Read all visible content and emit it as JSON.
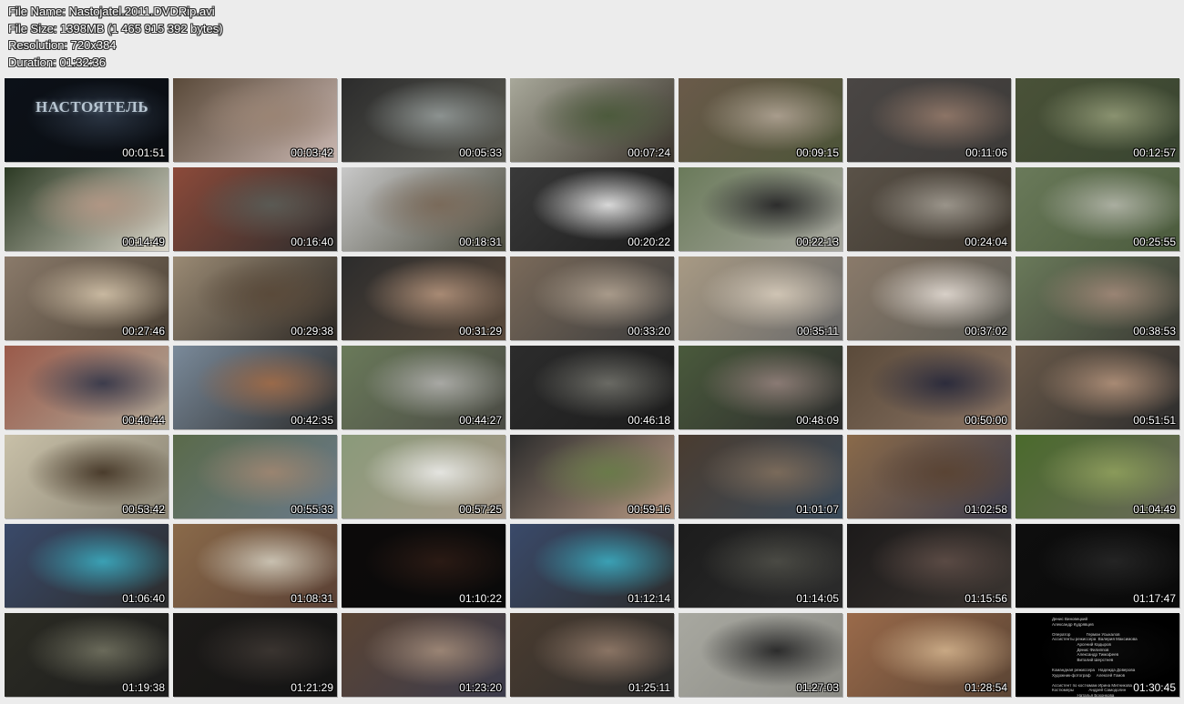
{
  "header": {
    "file_name": "File Name: Nastojatel.2011.DVDRip.avi",
    "file_size": "File Size: 1398MB (1 465 915 392 bytes)",
    "resolution": "Resolution: 720x384",
    "duration": "Duration: 01:32:36"
  },
  "first_frame_title": "НАСТОЯТЕЛЬ",
  "thumbnails": [
    {
      "time": "00:01:51",
      "colors": [
        "#0c1118",
        "#2a3442",
        "#0a0d12"
      ]
    },
    {
      "time": "00:03:42",
      "colors": [
        "#5a4a3a",
        "#9a8474",
        "#c9b6b0"
      ]
    },
    {
      "time": "00:05:33",
      "colors": [
        "#2c2c2c",
        "#8c9290",
        "#5a5a52"
      ]
    },
    {
      "time": "00:07:24",
      "colors": [
        "#a8a89a",
        "#4c5a3c",
        "#3a342c"
      ]
    },
    {
      "time": "00:09:15",
      "colors": [
        "#6a5a4a",
        "#a89c8c",
        "#4c5438"
      ]
    },
    {
      "time": "00:11:06",
      "colors": [
        "#4a4644",
        "#8c7466",
        "#3c3a38"
      ]
    },
    {
      "time": "00:12:57",
      "colors": [
        "#4a5238",
        "#8a9270",
        "#384430"
      ]
    },
    {
      "time": "00:14:49",
      "colors": [
        "#2c3a24",
        "#b09684",
        "#d8d4c8"
      ]
    },
    {
      "time": "00:16:40",
      "colors": [
        "#8c4a3a",
        "#5a5a54",
        "#2c2c2c"
      ]
    },
    {
      "time": "00:18:31",
      "colors": [
        "#c8c8c8",
        "#7a6a5a",
        "#4a4a3c"
      ]
    },
    {
      "time": "00:20:22",
      "colors": [
        "#3a3a3a",
        "#d8d8d8",
        "#1c1c1c"
      ]
    },
    {
      "time": "00:22:13",
      "colors": [
        "#6a7a5a",
        "#2c2c2c",
        "#a8a8a0"
      ]
    },
    {
      "time": "00:24:04",
      "colors": [
        "#5a5248",
        "#9a948a",
        "#3a342c"
      ]
    },
    {
      "time": "00:25:55",
      "colors": [
        "#6a7a5a",
        "#aaaea0",
        "#4a5a3c"
      ]
    },
    {
      "time": "00:27:46",
      "colors": [
        "#8a7a6a",
        "#c8b8a0",
        "#4a4034"
      ]
    },
    {
      "time": "00:29:38",
      "colors": [
        "#9a8a74",
        "#5a4a3a",
        "#2c2824"
      ]
    },
    {
      "time": "00:31:29",
      "colors": [
        "#2c2c2c",
        "#a88a74",
        "#5a4a3c"
      ]
    },
    {
      "time": "00:33:20",
      "colors": [
        "#7a6a5a",
        "#a89a8a",
        "#3c3c3c"
      ]
    },
    {
      "time": "00:35:11",
      "colors": [
        "#a89a84",
        "#cfc4b4",
        "#6a6a6a"
      ]
    },
    {
      "time": "00:37:02",
      "colors": [
        "#8a7a6a",
        "#d8d0c8",
        "#5a5a54"
      ]
    },
    {
      "time": "00:38:53",
      "colors": [
        "#6a7a5a",
        "#9a8474",
        "#3a3a34"
      ]
    },
    {
      "time": "00:40:44",
      "colors": [
        "#9a5a4a",
        "#3c3c4c",
        "#b0a898"
      ]
    },
    {
      "time": "00:42:35",
      "colors": [
        "#7a8a9a",
        "#9a6a4a",
        "#2c2c2c"
      ]
    },
    {
      "time": "00:44:27",
      "colors": [
        "#6a7a5a",
        "#a8a8a4",
        "#4a4a44"
      ]
    },
    {
      "time": "00:46:18",
      "colors": [
        "#2c2c2c",
        "#6a6a64",
        "#1c1c1c"
      ]
    },
    {
      "time": "00:48:09",
      "colors": [
        "#4a5a3c",
        "#8a7a74",
        "#2c2c2c"
      ]
    },
    {
      "time": "00:50:00",
      "colors": [
        "#5a4a3a",
        "#2c2c3c",
        "#8a7464"
      ]
    },
    {
      "time": "00:51:51",
      "colors": [
        "#6a5a4a",
        "#a88a74",
        "#2c2c2c"
      ]
    },
    {
      "time": "00:53:42",
      "colors": [
        "#c8c0a8",
        "#4a3c2c",
        "#8a8474"
      ]
    },
    {
      "time": "00:55:33",
      "colors": [
        "#5a6a4a",
        "#9a8470",
        "#6a7a8a"
      ]
    },
    {
      "time": "00:57:25",
      "colors": [
        "#8a9a7a",
        "#e4e4e0",
        "#a89a8a"
      ]
    },
    {
      "time": "00:59:16",
      "colors": [
        "#2c2c2c",
        "#6a7a4a",
        "#b89a84"
      ]
    },
    {
      "time": "01:01:07",
      "colors": [
        "#4a3c30",
        "#7a6a5a",
        "#3a4a5a"
      ]
    },
    {
      "time": "01:02:58",
      "colors": [
        "#8a6a4a",
        "#5a4434",
        "#3c3c4c"
      ]
    },
    {
      "time": "01:04:49",
      "colors": [
        "#4a6a2c",
        "#8a9a5a",
        "#6a6a5a"
      ]
    },
    {
      "time": "01:06:40",
      "colors": [
        "#3a4a6a",
        "#3aa0b4",
        "#2c2c2c"
      ]
    },
    {
      "time": "01:08:31",
      "colors": [
        "#8a6a4a",
        "#c8c0b0",
        "#5a4034"
      ]
    },
    {
      "time": "01:10:22",
      "colors": [
        "#0c0a0a",
        "#2a1a14",
        "#0a0a0a"
      ]
    },
    {
      "time": "01:12:14",
      "colors": [
        "#3a4a6a",
        "#3aa0b4",
        "#2c2c2c"
      ]
    },
    {
      "time": "01:14:05",
      "colors": [
        "#1c1c1c",
        "#4a4a44",
        "#2c2c2c"
      ]
    },
    {
      "time": "01:15:56",
      "colors": [
        "#1c1a1a",
        "#5a4a44",
        "#3a3430"
      ]
    },
    {
      "time": "01:17:47",
      "colors": [
        "#0e0e0e",
        "#242424",
        "#0a0a0a"
      ]
    },
    {
      "time": "01:19:38",
      "colors": [
        "#2c2c24",
        "#6a6a5a",
        "#1c1c1c"
      ]
    },
    {
      "time": "01:21:29",
      "colors": [
        "#1c1a18",
        "#3a3430",
        "#141414"
      ]
    },
    {
      "time": "01:23:20",
      "colors": [
        "#5a4434",
        "#9a8474",
        "#3c3c4c"
      ]
    },
    {
      "time": "01:25:11",
      "colors": [
        "#4a3c30",
        "#8a7464",
        "#2c2c2c"
      ]
    },
    {
      "time": "01:27:03",
      "colors": [
        "#a8a8a0",
        "#2c2c2c",
        "#8a8a84"
      ]
    },
    {
      "time": "01:28:54",
      "colors": [
        "#9a6a4a",
        "#c8a884",
        "#5a4434"
      ]
    },
    {
      "time": "01:30:45",
      "colors": [
        "#000000",
        "#0a0a0a",
        "#000000"
      ]
    }
  ],
  "credits_text": "Денис Виновецкий\nАлександр Кудрявцев\n\nОператор              Герман Усыкалов\nАссистенты режиссера  Валерия Максимова\n                      Арсений Кадыров\n                      Денис Филиппов\n                      Александр Тимофеев\n                      Виталий Шерстнев\n\nКомандная режиссера   Надежда Доверова\nХудожник-фотограф     Алексей Гомов\n\nАссистент по костюмам Ирина Митникова\nКостюмеры             Андрей Самодолин\n                      Наталья Бохонкова\n                      Флора Ипатова\nГример                Евгения Матвеева"
}
